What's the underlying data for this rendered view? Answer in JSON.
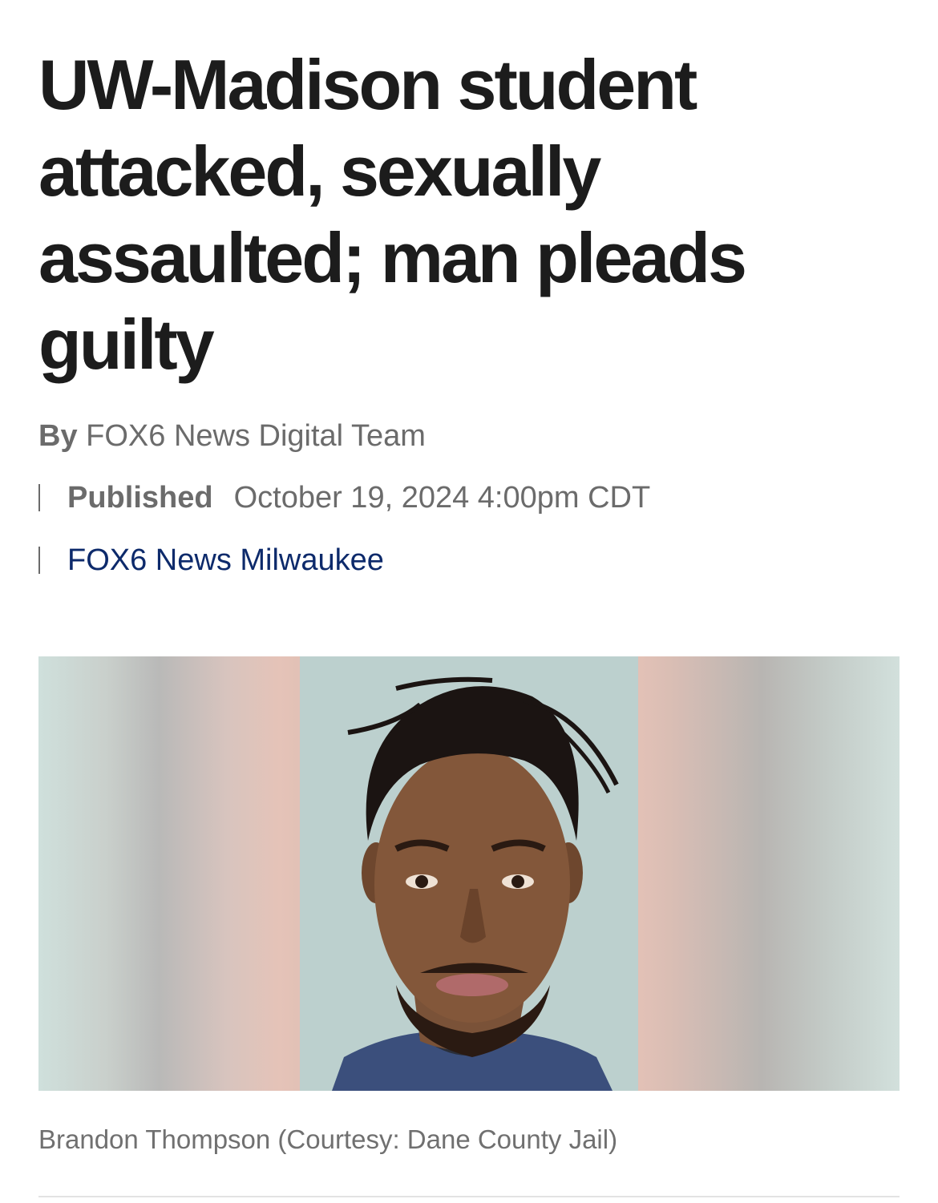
{
  "article": {
    "headline": "UW-Madison student attacked, sexually assaulted; man pleads guilty",
    "byline_prefix": "By",
    "author": "FOX6 News Digital Team",
    "published_label": "Published",
    "published_date": "October 19, 2024 4:00pm CDT",
    "station": "FOX6 News Milwaukee"
  },
  "image": {
    "caption": "Brandon Thompson (Courtesy: Dane County Jail)"
  },
  "colors": {
    "headline": "#1c1c1c",
    "meta_text": "#6b6b6b",
    "station_link": "#0d2a6b",
    "caption": "#707070"
  }
}
